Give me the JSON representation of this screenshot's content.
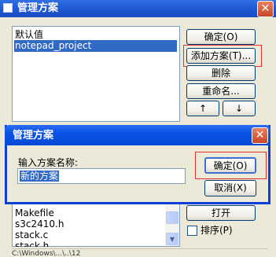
{
  "window": {
    "title": "管理方案",
    "close_glyph": "✕"
  },
  "scheme_list": {
    "items": [
      "默认值",
      "notepad_project"
    ],
    "selected_index": 1
  },
  "buttons": {
    "ok": "确定(O)",
    "add_scheme": "添加方案(T)...",
    "delete": "删除",
    "rename": "重命名...",
    "move_up": "↑",
    "move_down": "↓",
    "open": "打开",
    "sort": "排序(P)"
  },
  "file_list": {
    "items": [
      "Makefile",
      "s3c2410.h",
      "stack.c",
      "stack.h"
    ]
  },
  "bottom_fragment": "C:\\Windows\\...\\..\\12",
  "dialog": {
    "title": "管理方案",
    "close_glyph": "✕",
    "label": "输入方案名称:",
    "input_value": "新的方案",
    "ok": "确定(O)",
    "cancel": "取消(X)"
  },
  "colors": {
    "titlebar": "#1d54d1",
    "selection": "#316ac5",
    "highlight_border": "#e0312d",
    "close_button": "#d8542f"
  }
}
